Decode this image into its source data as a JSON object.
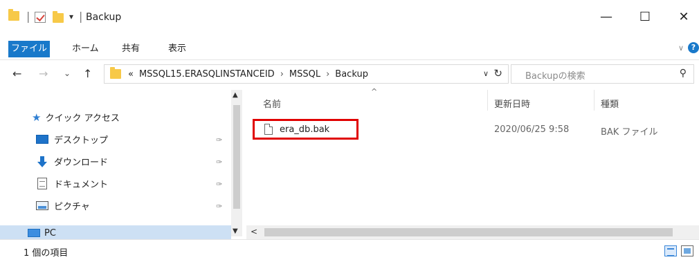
{
  "window": {
    "title": "Backup",
    "title_separator": "|",
    "qa_dropdown": "▾",
    "minimize": "—",
    "maximize": "☐",
    "close": "✕"
  },
  "ribbon": {
    "tabs": [
      {
        "label": "ファイル",
        "active": true
      },
      {
        "label": "ホーム"
      },
      {
        "label": "共有"
      },
      {
        "label": "表示"
      }
    ],
    "expand": "∨",
    "help": "?"
  },
  "address": {
    "back": "←",
    "forward": "→",
    "recent": "⌄",
    "up": "↑",
    "overflow": "«",
    "crumbs": [
      "MSSQL15.ERASQLINSTANCEID",
      "MSSQL",
      "Backup"
    ],
    "crumb_sep": "›",
    "dropdown": "∨",
    "refresh": "↻"
  },
  "search": {
    "placeholder": "Backupの検索",
    "icon": "⚲"
  },
  "nav_pane": {
    "quick_access": "クイック アクセス",
    "items": [
      {
        "label": "デスクトップ",
        "icon": "desktop-icon"
      },
      {
        "label": "ダウンロード",
        "icon": "download-icon"
      },
      {
        "label": "ドキュメント",
        "icon": "document-icon"
      },
      {
        "label": "ピクチャ",
        "icon": "pictures-icon"
      }
    ],
    "pin_glyph": "✑",
    "this_pc": "PC"
  },
  "file_list": {
    "columns": [
      "名前",
      "更新日時",
      "種類"
    ],
    "sort_arrow": "^",
    "files": [
      {
        "name": "era_db.bak",
        "modified": "2020/06/25 9:58",
        "type": "BAK ファイル",
        "highlighted": true
      }
    ]
  },
  "scroll": {
    "up": "▲",
    "down": "▼",
    "left": "<"
  },
  "status": {
    "item_count": "1 個の項目"
  },
  "colors": {
    "accent": "#1979ca",
    "highlight_box": "#e00000",
    "selected_row": "#cde0f4"
  }
}
